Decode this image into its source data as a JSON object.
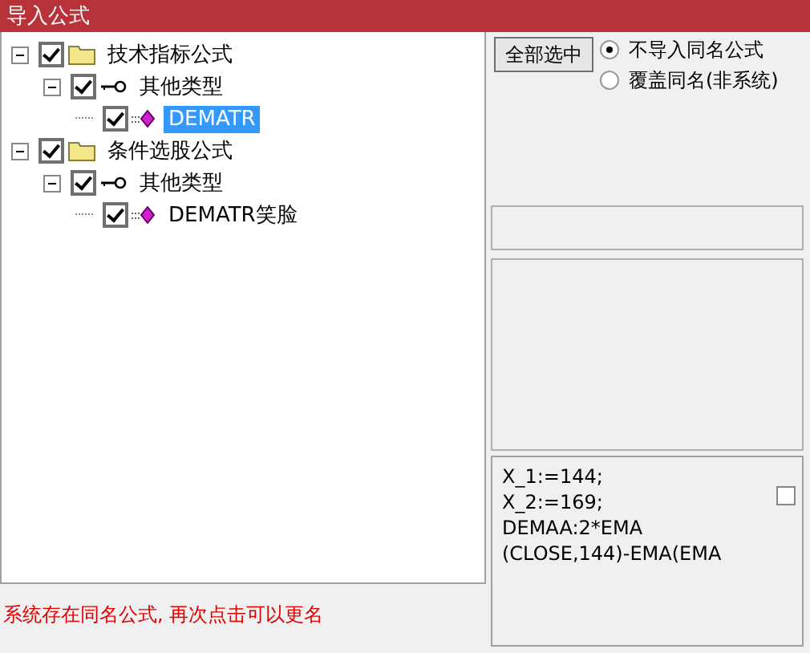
{
  "window": {
    "title": "导入公式"
  },
  "tree": [
    {
      "label": "技术指标公式",
      "kind": "folder",
      "checked": true,
      "expanded": true,
      "selected": false,
      "children": [
        {
          "label": "其他类型",
          "kind": "type",
          "checked": true,
          "expanded": true,
          "selected": false,
          "children": [
            {
              "label": "DEMATR",
              "kind": "formula",
              "checked": true,
              "selected": true
            }
          ]
        }
      ]
    },
    {
      "label": "条件选股公式",
      "kind": "folder",
      "checked": true,
      "expanded": true,
      "selected": false,
      "children": [
        {
          "label": "其他类型",
          "kind": "type",
          "checked": true,
          "expanded": true,
          "selected": false,
          "children": [
            {
              "label": "DEMATR笑脸",
              "kind": "formula",
              "checked": true,
              "selected": false
            }
          ]
        }
      ]
    }
  ],
  "select_all_button": "全部选中",
  "options": [
    {
      "label": "不导入同名公式",
      "selected": true
    },
    {
      "label": "覆盖同名(非系统)",
      "selected": false
    }
  ],
  "code_lines": [
    "X_1:=144;",
    "X_2:=169;",
    "DEMAA:2*EMA",
    "(CLOSE,144)-EMA(EMA"
  ],
  "code_checkbox": {
    "checked": false
  },
  "status": "系统存在同名公式, 再次点击可以更名"
}
